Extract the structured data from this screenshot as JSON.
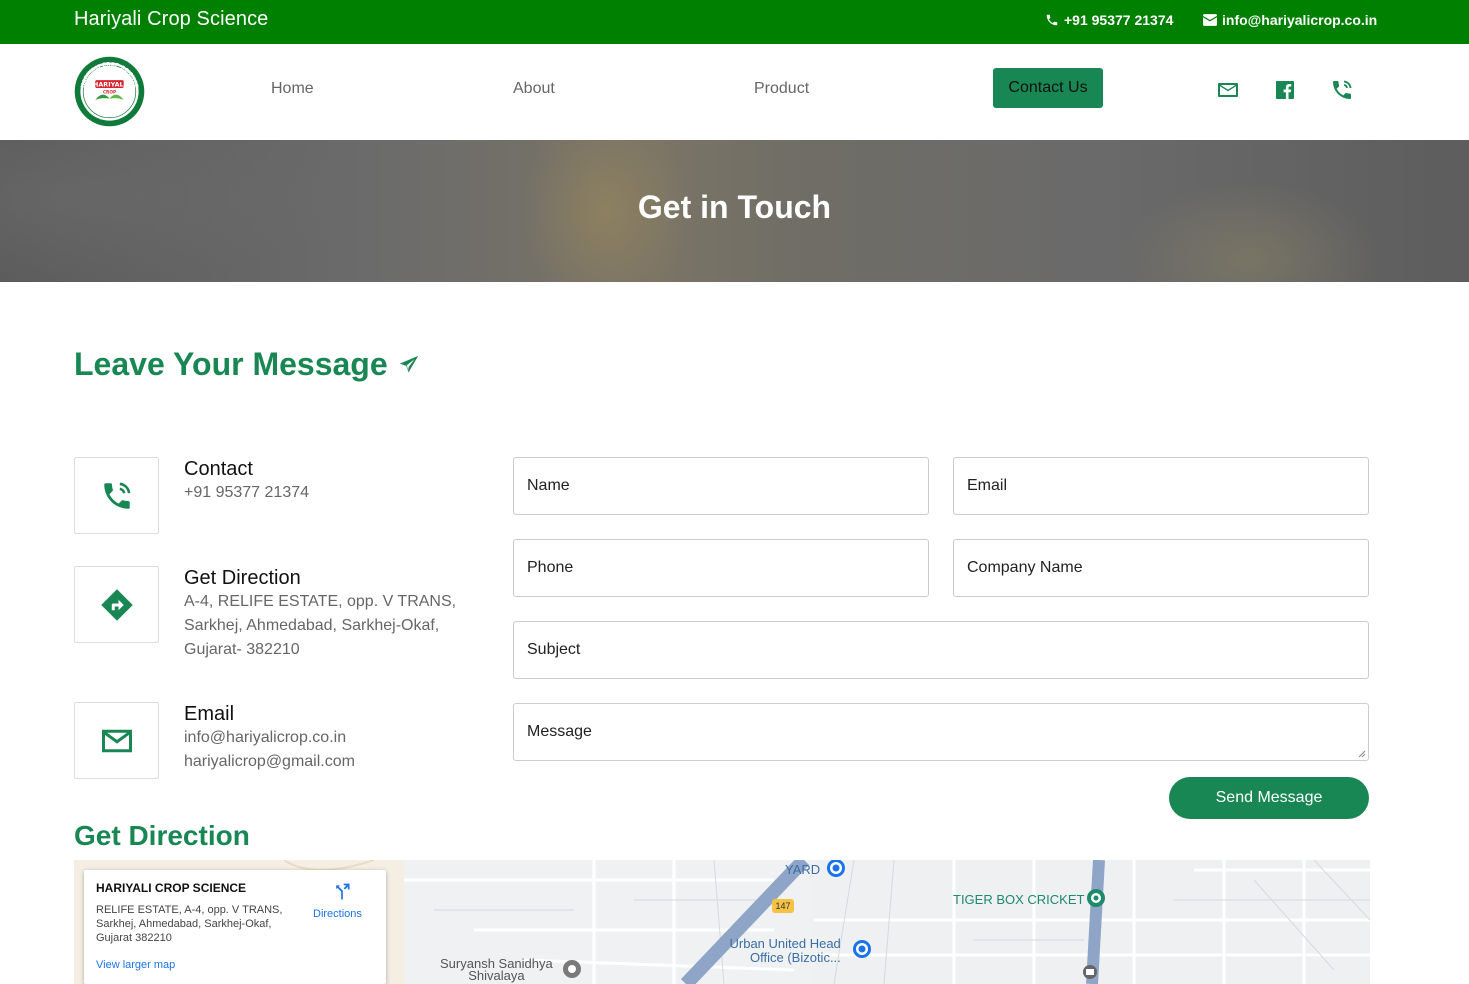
{
  "topbar": {
    "brand": "Hariyali Crop Science",
    "phone": "+91 95377 21374",
    "email": "info@hariyalicrop.co.in"
  },
  "nav": {
    "logo_text_top": "HARIYALI CROP SCIENCE",
    "logo_text_mid": "HARIYALI",
    "logo_text_sub": "CROP",
    "links": [
      "Home",
      "About",
      "Product"
    ],
    "cta": "Contact Us",
    "icons": [
      "mail-icon",
      "facebook-icon",
      "phone-icon"
    ]
  },
  "hero": {
    "title": "Get in Touch"
  },
  "leave": {
    "title": "Leave Your Message"
  },
  "info": {
    "contact": {
      "title": "Contact",
      "lines": [
        "+91 95377 21374"
      ]
    },
    "direction": {
      "title": "Get Direction",
      "lines": [
        "A-4, RELIFE ESTATE, opp. V TRANS,",
        "Sarkhej, Ahmedabad, Sarkhej-Okaf,",
        "Gujarat- 382210"
      ]
    },
    "email": {
      "title": "Email",
      "lines": [
        "info@hariyalicrop.co.in",
        "hariyalicrop@gmail.com"
      ]
    }
  },
  "form": {
    "name": "Name",
    "email": "Email",
    "phone": "Phone",
    "company": "Company Name",
    "subject": "Subject",
    "message": "Message",
    "submit": "Send Message"
  },
  "direction_section": {
    "title": "Get Direction"
  },
  "map": {
    "card_title": "HARIYALI CROP SCIENCE",
    "card_address": "RELIFE ESTATE, A-4, opp. V TRANS, Sarkhej, Ahmedabad, Sarkhej-Okaf, Gujarat 382210",
    "directions": "Directions",
    "view_larger": "View larger map",
    "labels": {
      "yard": "YARD",
      "tiger": "TIGER BOX CRICKET",
      "urban_1": "Urban United Head",
      "urban_2": "Office (Bizotic...",
      "surya_1": "Suryansh Sanidhya",
      "surya_2": "Shivalaya",
      "route": "147"
    }
  },
  "colors": {
    "topbar": "#008000",
    "accent": "#198754",
    "text_muted": "#666666"
  }
}
